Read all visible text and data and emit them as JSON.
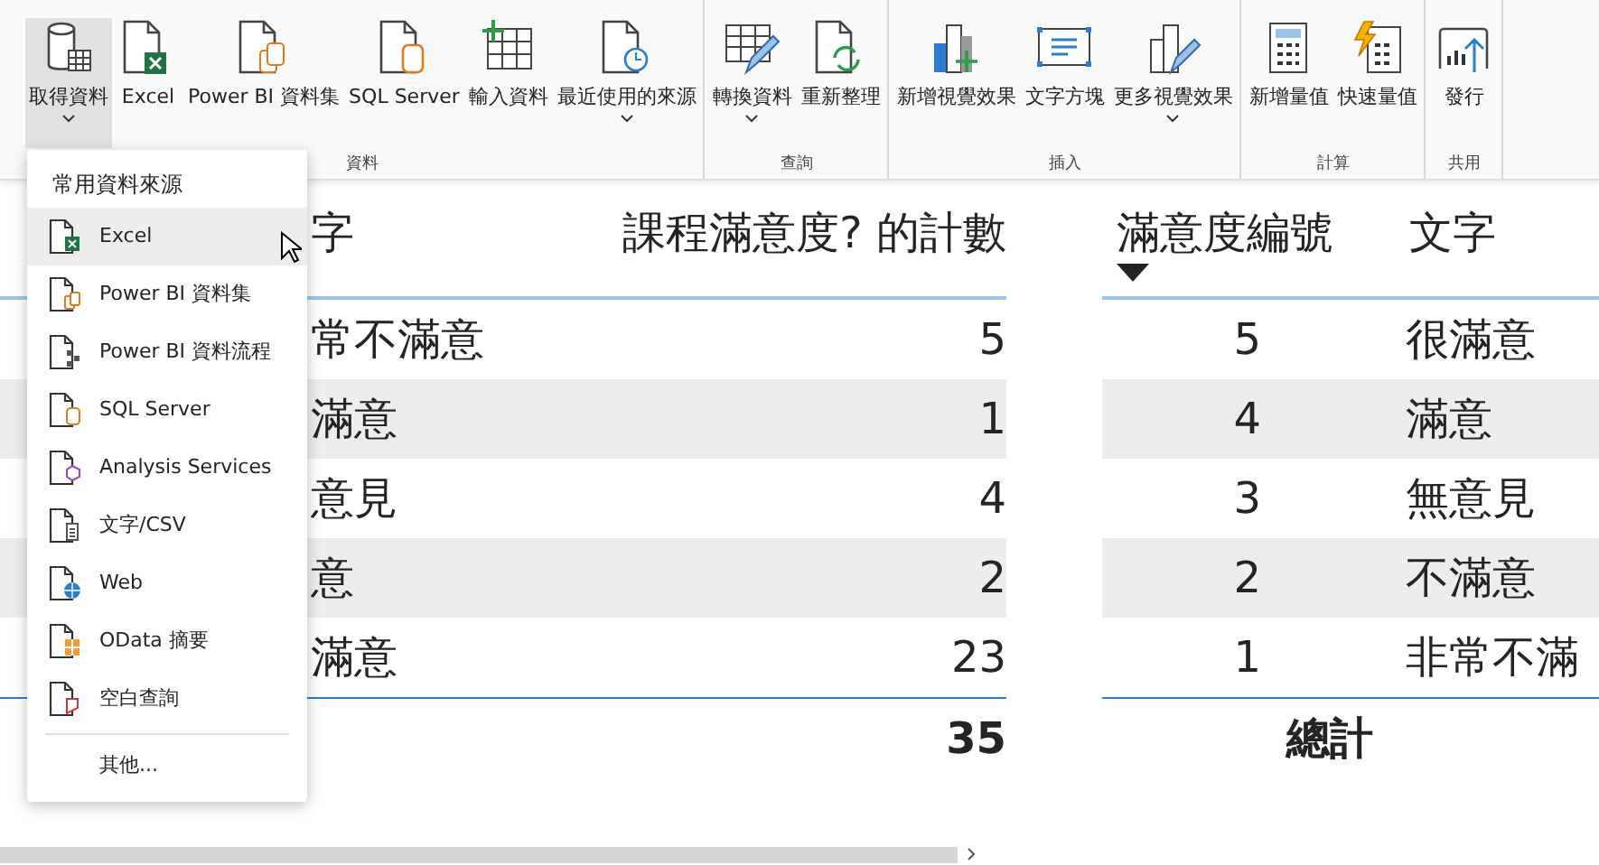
{
  "ribbon": {
    "groups": [
      {
        "label": "資料",
        "buttons": [
          {
            "label": "取得資料",
            "dropdown": true,
            "selected": true
          },
          {
            "label": "Excel",
            "dropdown": false,
            "selected": false
          },
          {
            "label": "Power BI 資料集",
            "dropdown": false,
            "selected": false
          },
          {
            "label": "SQL Server",
            "dropdown": false,
            "selected": false
          },
          {
            "label": "輸入資料",
            "dropdown": false,
            "selected": false
          },
          {
            "label": "最近使用的來源",
            "dropdown": true,
            "selected": false
          }
        ]
      },
      {
        "label": "查詢",
        "buttons": [
          {
            "label": "轉換資料",
            "dropdown": true,
            "selected": false
          },
          {
            "label": "重新整理",
            "dropdown": false,
            "selected": false
          }
        ]
      },
      {
        "label": "插入",
        "buttons": [
          {
            "label": "新增視覺效果",
            "dropdown": false,
            "selected": false
          },
          {
            "label": "文字方塊",
            "dropdown": false,
            "selected": false
          },
          {
            "label": "更多視覺效果",
            "dropdown": true,
            "selected": false
          }
        ]
      },
      {
        "label": "計算",
        "buttons": [
          {
            "label": "新增量值",
            "dropdown": false,
            "selected": false
          },
          {
            "label": "快速量值",
            "dropdown": false,
            "selected": false
          }
        ]
      },
      {
        "label": "共用",
        "buttons": [
          {
            "label": "發行",
            "dropdown": false,
            "selected": false
          }
        ]
      }
    ]
  },
  "menu": {
    "title": "常用資料來源",
    "items": [
      {
        "label": "Excel",
        "selected": true
      },
      {
        "label": "Power BI 資料集",
        "selected": false
      },
      {
        "label": "Power BI 資料流程",
        "selected": false
      },
      {
        "label": "SQL Server",
        "selected": false
      },
      {
        "label": "Analysis Services",
        "selected": false
      },
      {
        "label": "文字/CSV",
        "selected": false
      },
      {
        "label": "Web",
        "selected": false
      },
      {
        "label": "OData 摘要",
        "selected": false
      },
      {
        "label": "空白查詢",
        "selected": false
      }
    ],
    "more": "其他..."
  },
  "left_table": {
    "columns": [
      "字",
      "課程滿意度? 的計數"
    ],
    "rows": [
      [
        "常不滿意",
        "5"
      ],
      [
        "滿意",
        "1"
      ],
      [
        "意見",
        "4"
      ],
      [
        "意",
        "2"
      ],
      [
        "滿意",
        "23"
      ]
    ],
    "total": "35"
  },
  "right_table": {
    "columns": [
      "滿意度編號",
      "文字"
    ],
    "rows": [
      [
        "5",
        "很滿意"
      ],
      [
        "4",
        "滿意"
      ],
      [
        "3",
        "無意見"
      ],
      [
        "2",
        "不滿意"
      ],
      [
        "1",
        "非常不滿"
      ]
    ],
    "total": "總計"
  }
}
